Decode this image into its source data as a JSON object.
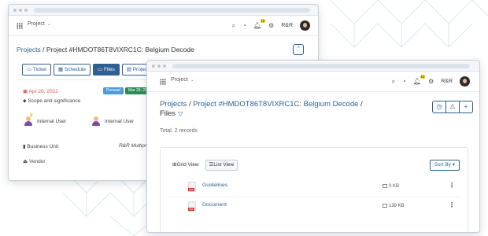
{
  "topbar": {
    "project_select": "Project",
    "notification_count": "19",
    "user_initials": "R&R"
  },
  "back_window": {
    "breadcrumb": {
      "projects_link": "Projects",
      "separator": "/",
      "project_link": "Project #HMDOT86T8VIXRC1C: Belgium Decode"
    },
    "tabs": [
      {
        "label": "Ticket",
        "icon": "ticket-icon"
      },
      {
        "label": "Schedule",
        "icon": "calendar-icon"
      },
      {
        "label": "Files",
        "icon": "folder-icon",
        "active": true
      },
      {
        "label": "Project Va",
        "icon": "document-icon"
      }
    ],
    "date": "Apr 28, 2022",
    "chip_blue": "Preread",
    "chip_green": "Mar 29, 2022",
    "scope": "Scope and significance",
    "users": [
      "Internal User",
      "Internal User"
    ],
    "business_unit_label": "Business Unit",
    "business_unit_value": "R&R Multiproje",
    "vendor_label": "Vendor"
  },
  "front_window": {
    "breadcrumb": {
      "projects_link": "Projects",
      "separator": "/",
      "project_link": "Project #HMDOT86T8VIXRC1C: Belgium Decode",
      "trailing_separator": "/",
      "current": "Files"
    },
    "actions": [
      "history-icon",
      "warning-icon",
      "add-icon"
    ],
    "total": "Total. 2 records",
    "view_toggle": {
      "grid_label": "Grid View",
      "list_label": "List View",
      "active": "list"
    },
    "sort_label": "Sort By",
    "files": [
      {
        "name": "Guidelines",
        "size": "0 KB"
      },
      {
        "name": "Document",
        "size": "139 KB"
      }
    ]
  },
  "colors": {
    "accent": "#2f5f93",
    "date_red": "#d9534f",
    "chip_blue": "#4d9bd6",
    "chip_green": "#2e8b57",
    "badge": "#f5c518"
  }
}
